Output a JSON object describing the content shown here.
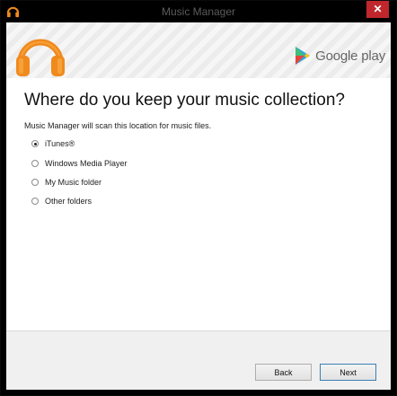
{
  "window": {
    "title": "Music Manager",
    "close_glyph": "✕"
  },
  "banner": {
    "brand_text": "Google play"
  },
  "main": {
    "heading": "Where do you keep your music collection?",
    "description": "Music Manager will scan this location for music files.",
    "options": [
      {
        "label": "iTunes®",
        "checked": true
      },
      {
        "label": "Windows Media Player",
        "checked": false
      },
      {
        "label": "My Music folder",
        "checked": false
      },
      {
        "label": "Other folders",
        "checked": false
      }
    ]
  },
  "footer": {
    "back_label": "Back",
    "next_label": "Next"
  },
  "colors": {
    "accent_orange": "#f08a1d",
    "close_red": "#c0272d"
  },
  "icons": {
    "app": "headphones-icon",
    "logo": "headphones-logo-icon",
    "play": "google-play-icon"
  }
}
